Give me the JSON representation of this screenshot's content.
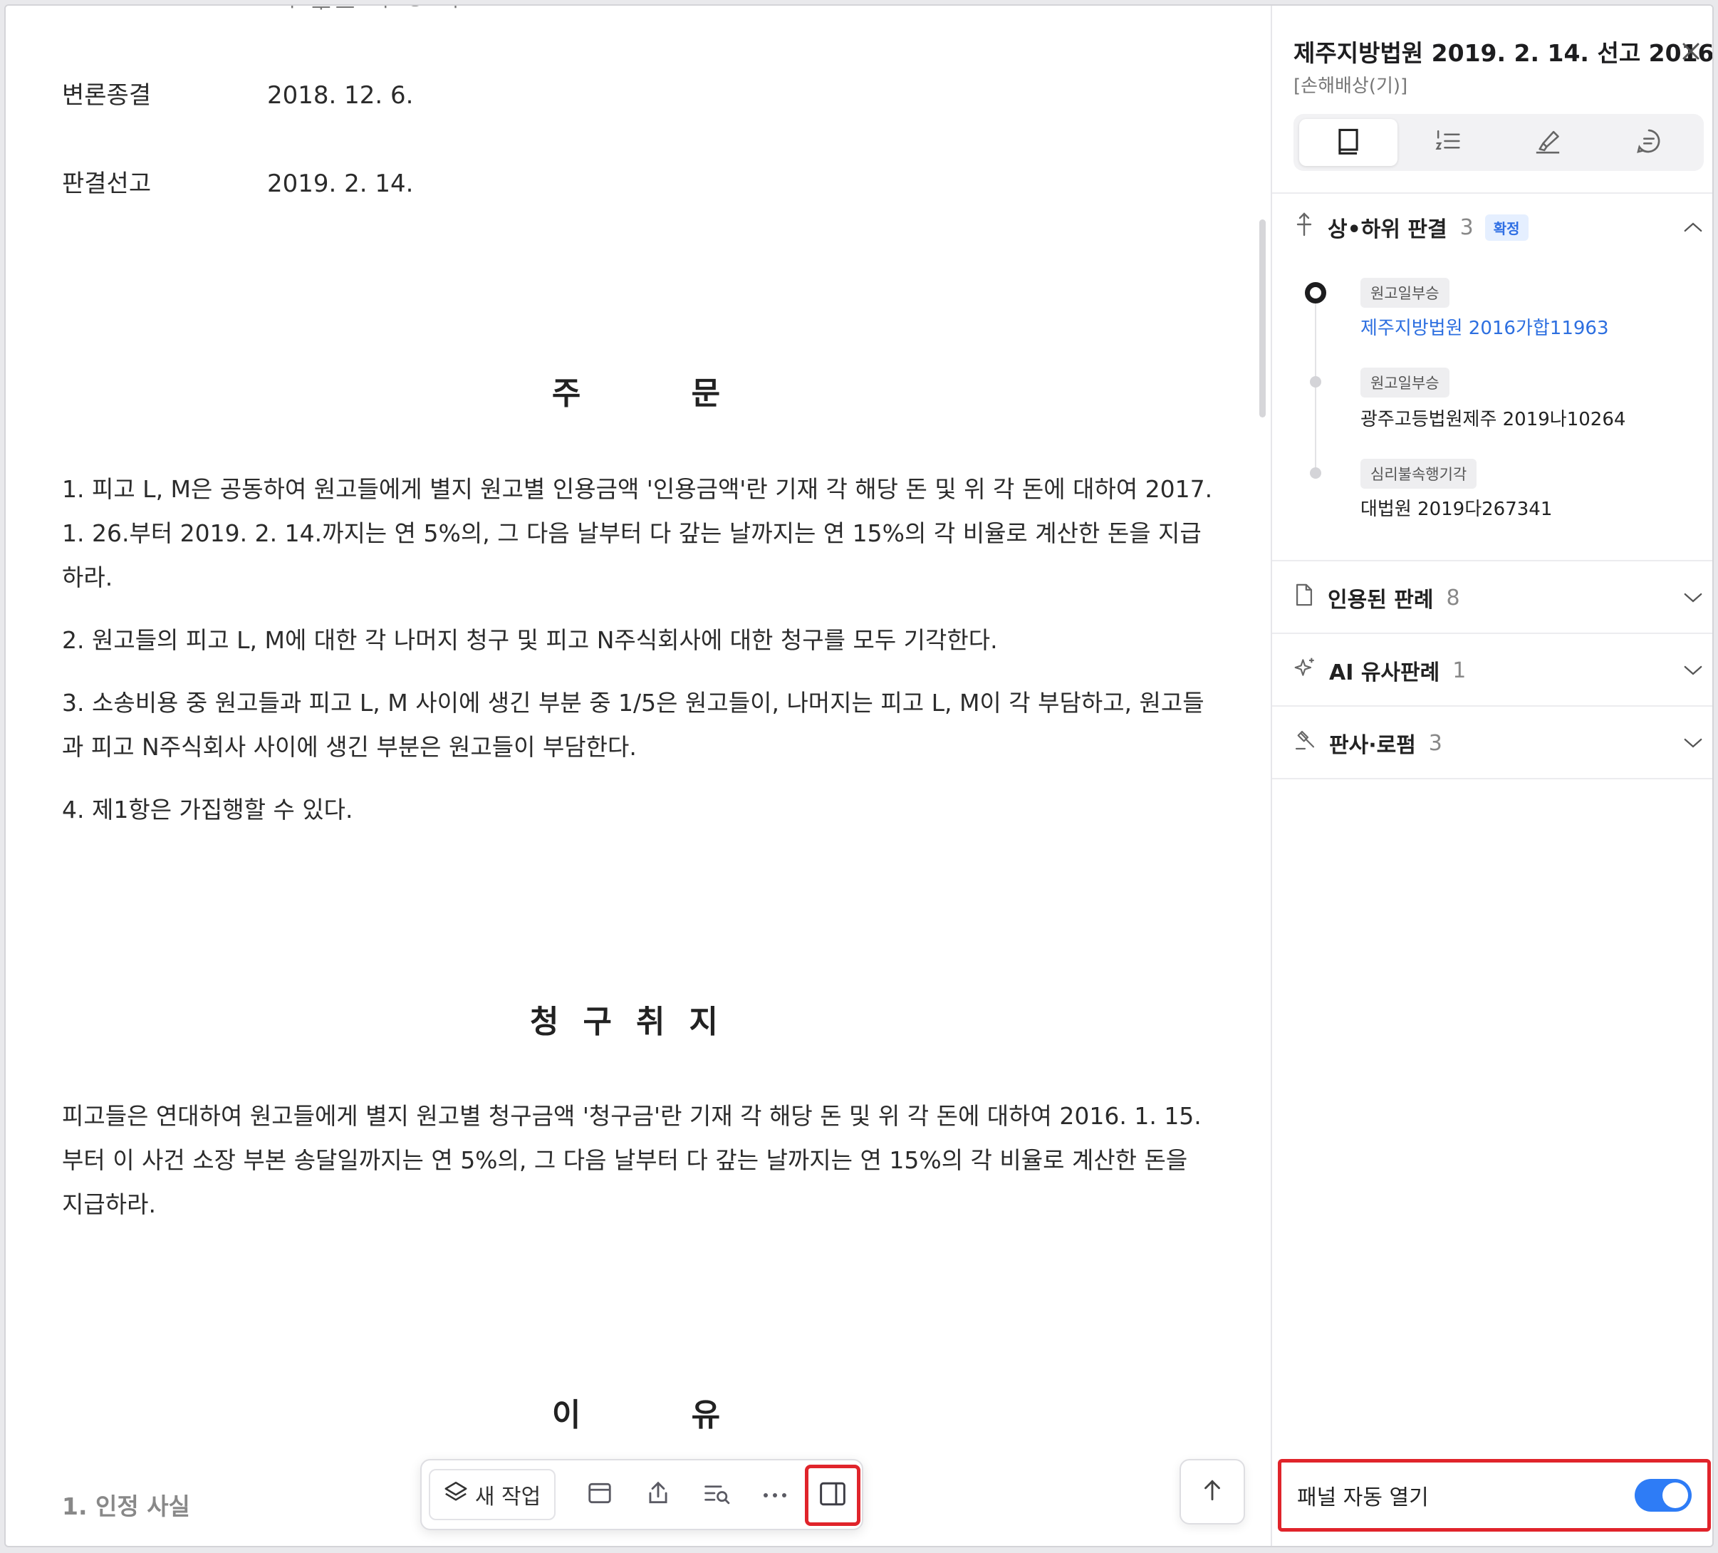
{
  "document": {
    "cut_line_text": "ᅥ ᅮᅳ ᅡ ᄋ ᅡ",
    "meta": [
      {
        "key": "변론종결",
        "value": "2018. 12. 6."
      },
      {
        "key": "판결선고",
        "value": "2019. 2. 14."
      }
    ],
    "heading_order": "주 문",
    "order_items": [
      "1. 피고 L, M은 공동하여 원고들에게 별지 원고별 인용금액 '인용금액'란 기재 각 해당 돈 및 위 각 돈에 대하여 2017. 1. 26.부터 2019. 2. 14.까지는 연 5%의, 그 다음 날부터 다 갚는 날까지는 연 15%의 각 비율로 계산한 돈을 지급하라.",
      "2. 원고들의 피고 L, M에 대한 각 나머지 청구 및 피고 N주식회사에 대한 청구를 모두 기각한다.",
      "3. 소송비용 중 원고들과 피고 L, M 사이에 생긴 부분 중 1/5은 원고들이, 나머지는 피고 L, M이 각 부담하고, 원고들과 피고 N주식회사 사이에 생긴 부분은 원고들이 부담한다.",
      "4. 제1항은 가집행할 수 있다."
    ],
    "heading_claim": "청구취지",
    "claim_text": "피고들은 연대하여 원고들에게 별지 원고별 청구금액 '청구금'란 기재 각 해당 돈 및 위 각 돈에 대하여 2016. 1. 15.부터 이 사건 소장 부본 송달일까지는 연 5%의, 그 다음 날부터 다 갚는 날까지는 연 15%의 각 비율로 계산한 돈을 지급하라.",
    "heading_reason": "이 유",
    "sub_heading": "1. 인정 사실"
  },
  "toolbar": {
    "new_task_label": "새 작업",
    "icons": [
      "layers-icon",
      "save-icon",
      "share-icon",
      "search-list-icon",
      "more-icon",
      "panel-toggle-icon"
    ]
  },
  "panel": {
    "title": "제주지방법원 2019. 2. 14. 선고 2016...",
    "subtitle": "[손해배상(기)]",
    "tabs": [
      "book-icon",
      "numbered-list-icon",
      "highlighter-icon",
      "comment-icon"
    ],
    "sections": {
      "appeals": {
        "label": "상•하위 판결",
        "count": "3",
        "badge": "확정"
      },
      "cited": {
        "label": "인용된 판례",
        "count": "8"
      },
      "ai_similar": {
        "label": "AI 유사판례",
        "count": "1"
      },
      "judges": {
        "label": "판사·로펌",
        "count": "3"
      }
    },
    "timeline": [
      {
        "chip": "원고일부승",
        "case": "제주지방법원 2016가합11963"
      },
      {
        "chip": "원고일부승",
        "case": "광주고등법원제주 2019나10264"
      },
      {
        "chip": "심리불속행기각",
        "case": "대법원 2019다267341"
      }
    ],
    "auto_open_label": "패널 자동 열기",
    "auto_open_state": true
  },
  "colors": {
    "accent": "#2e7cf6",
    "link": "#2d6fe0",
    "highlight": "#e0242b"
  }
}
